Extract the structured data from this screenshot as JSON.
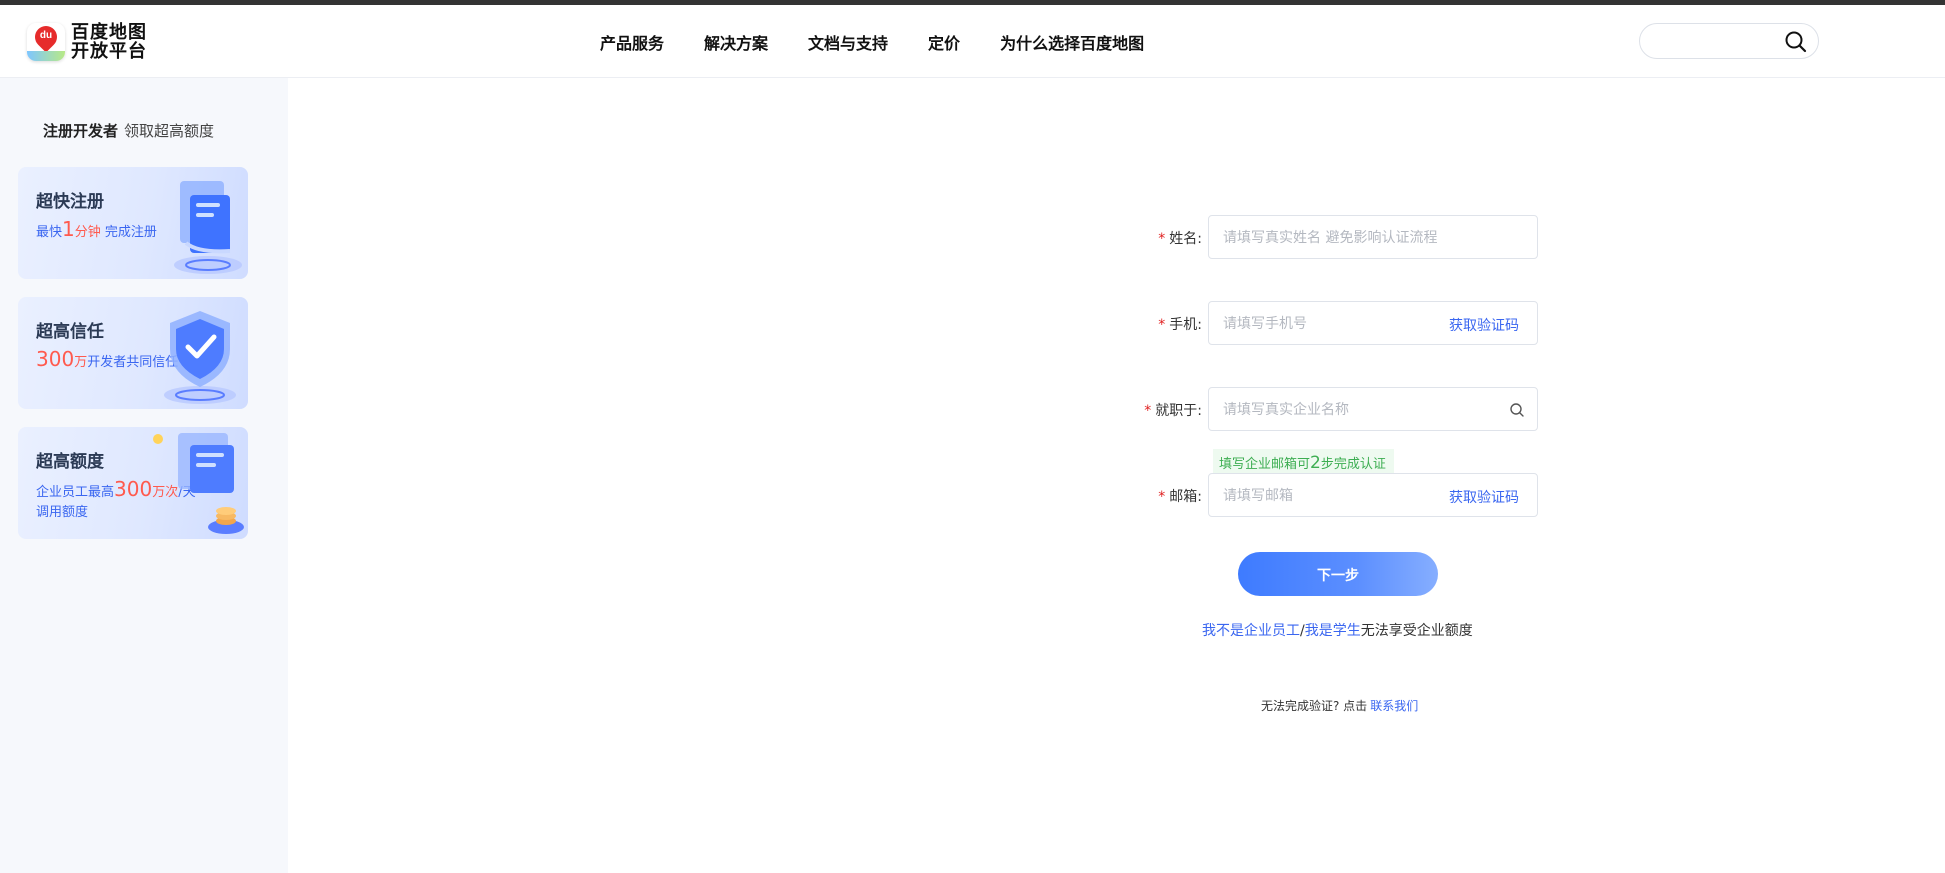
{
  "brand": {
    "logo_mark_text": "du",
    "logo_line1": "百度地图",
    "logo_line2": "开放平台"
  },
  "nav": {
    "items": [
      "产品服务",
      "解决方案",
      "文档与支持",
      "定价",
      "为什么选择百度地图"
    ]
  },
  "search": {
    "placeholder": ""
  },
  "sidebar": {
    "heading_strong": "注册开发者",
    "heading_light": "领取超高额度",
    "cards": [
      {
        "title": "超快注册",
        "sub_pre": "最快",
        "sub_big": "1",
        "sub_red": "分钟",
        "sub_post": " 完成注册",
        "icon": "document-stack-icon"
      },
      {
        "title": "超高信任",
        "sub_big": "300",
        "sub_red": "万",
        "sub_post": "开发者共同信任",
        "icon": "shield-check-icon"
      },
      {
        "title": "超高额度",
        "sub_pre": "企业员工最高",
        "sub_big": "300",
        "sub_red": "万次",
        "sub_post": "/天",
        "sub_line2": "调用额度",
        "icon": "coin-stack-icon"
      }
    ]
  },
  "form": {
    "name": {
      "label": "姓名:",
      "placeholder": "请填写真实姓名 避免影响认证流程"
    },
    "phone": {
      "label": "手机:",
      "placeholder": "请填写手机号",
      "action": "获取验证码"
    },
    "company": {
      "label": "就职于:",
      "placeholder": "请填写真实企业名称"
    },
    "tip": {
      "pre": "填写企业邮箱可",
      "big": "2",
      "post": "步完成认证"
    },
    "email": {
      "label": "邮箱:",
      "placeholder": "请填写邮箱",
      "action": "获取验证码"
    },
    "required_mark": "*",
    "next_label": "下一步",
    "alt": {
      "link1": "我不是企业员工",
      "sep": "/",
      "link2": "我是学生",
      "suffix": "无法享受企业额度"
    },
    "help": {
      "text": "无法完成验证? 点击",
      "link": "联系我们"
    }
  },
  "colors": {
    "accent": "#3a66f0",
    "required": "#e02020",
    "tip_green": "#3dae52",
    "highlight_red": "#ff5a4e"
  }
}
